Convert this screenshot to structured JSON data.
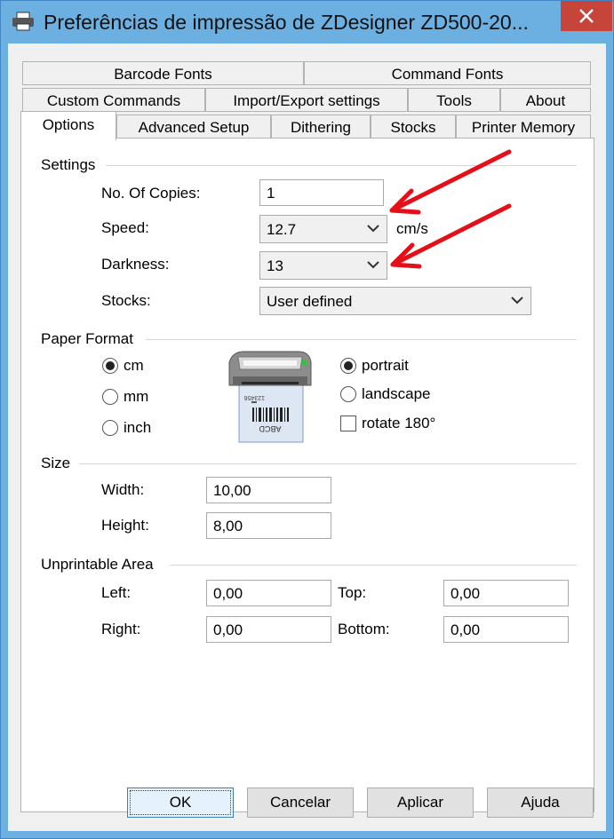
{
  "window": {
    "title": "Preferências de impressão de ZDesigner ZD500-20...",
    "title_icon": "printer-icon",
    "close_icon": "close-icon"
  },
  "tabs": {
    "row1": [
      "Barcode Fonts",
      "Command Fonts"
    ],
    "row2": [
      "Custom Commands",
      "Import/Export settings",
      "Tools",
      "About"
    ],
    "row3": [
      "Options",
      "Advanced Setup",
      "Dithering",
      "Stocks",
      "Printer Memory"
    ],
    "active": "Options"
  },
  "settings": {
    "group_label": "Settings",
    "copies_label": "No. Of Copies:",
    "copies_value": "1",
    "speed_label": "Speed:",
    "speed_value": "12.7",
    "speed_unit": "cm/s",
    "darkness_label": "Darkness:",
    "darkness_value": "13",
    "stocks_label": "Stocks:",
    "stocks_value": "User defined"
  },
  "paper_format": {
    "group_label": "Paper Format",
    "units": [
      "cm",
      "mm",
      "inch"
    ],
    "selected_unit": "cm",
    "orientations": [
      "portrait",
      "landscape"
    ],
    "selected_orientation": "portrait",
    "rotate_label": "rotate 180°",
    "rotate_checked": false,
    "preview_label_text": "ABCD",
    "preview_number_text": "123456"
  },
  "size": {
    "group_label": "Size",
    "width_label": "Width:",
    "width_value": "10,00",
    "height_label": "Height:",
    "height_value": "8,00"
  },
  "unprintable": {
    "group_label": "Unprintable Area",
    "left_label": "Left:",
    "left_value": "0,00",
    "top_label": "Top:",
    "top_value": "0,00",
    "right_label": "Right:",
    "right_value": "0,00",
    "bottom_label": "Bottom:",
    "bottom_value": "0,00"
  },
  "buttons": {
    "ok": "OK",
    "cancel": "Cancelar",
    "apply": "Aplicar",
    "help": "Ajuda"
  },
  "colors": {
    "window_frame": "#6bb0e0",
    "close_button": "#c7443b",
    "annotation_arrow": "#e3101a"
  }
}
